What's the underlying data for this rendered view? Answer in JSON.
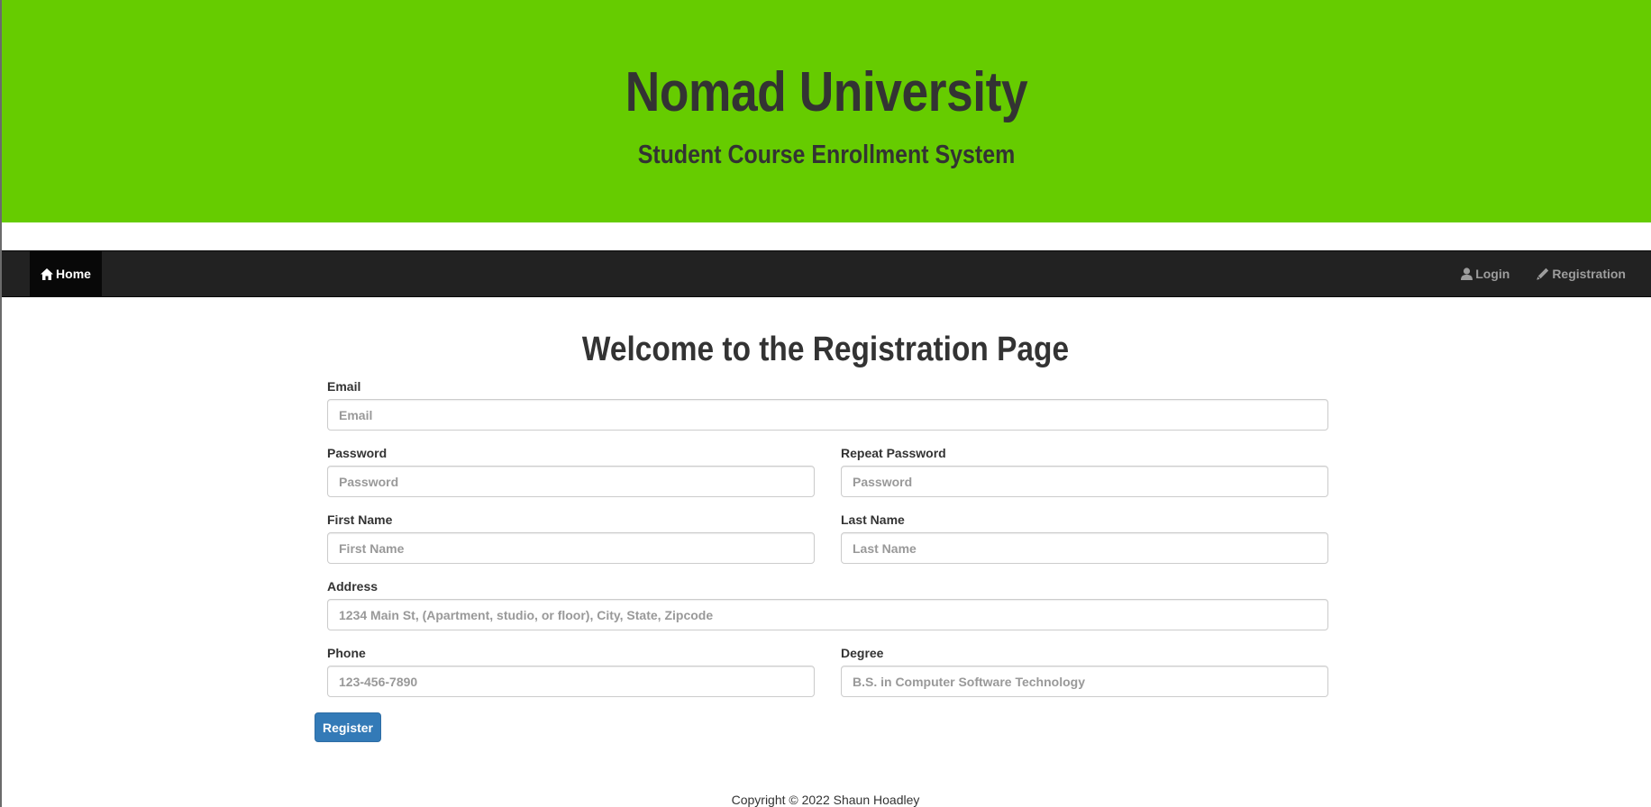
{
  "header": {
    "title": "Nomad University",
    "subtitle": "Student Course Enrollment System",
    "background_color": "#66cc00"
  },
  "navbar": {
    "home_label": "Home",
    "home_icon": "home-icon",
    "login_label": "Login",
    "login_icon": "user-icon",
    "registration_label": "Registration",
    "registration_icon": "pencil-icon"
  },
  "page": {
    "title": "Welcome to the Registration Page"
  },
  "form": {
    "email": {
      "label": "Email",
      "placeholder": "Email",
      "value": ""
    },
    "password": {
      "label": "Password",
      "placeholder": "Password",
      "value": ""
    },
    "repeat_password": {
      "label": "Repeat Password",
      "placeholder": "Password",
      "value": ""
    },
    "first_name": {
      "label": "First Name",
      "placeholder": "First Name",
      "value": ""
    },
    "last_name": {
      "label": "Last Name",
      "placeholder": "Last Name",
      "value": ""
    },
    "address": {
      "label": "Address",
      "placeholder": "1234 Main St, (Apartment, studio, or floor), City, State, Zipcode",
      "value": ""
    },
    "phone": {
      "label": "Phone",
      "placeholder": "123-456-7890",
      "value": ""
    },
    "degree": {
      "label": "Degree",
      "placeholder": "B.S. in Computer Software Technology",
      "value": ""
    },
    "submit_label": "Register",
    "submit_color": "#337ab7"
  },
  "footer": {
    "copyright": "Copyright © 2022 Shaun Hoadley"
  }
}
